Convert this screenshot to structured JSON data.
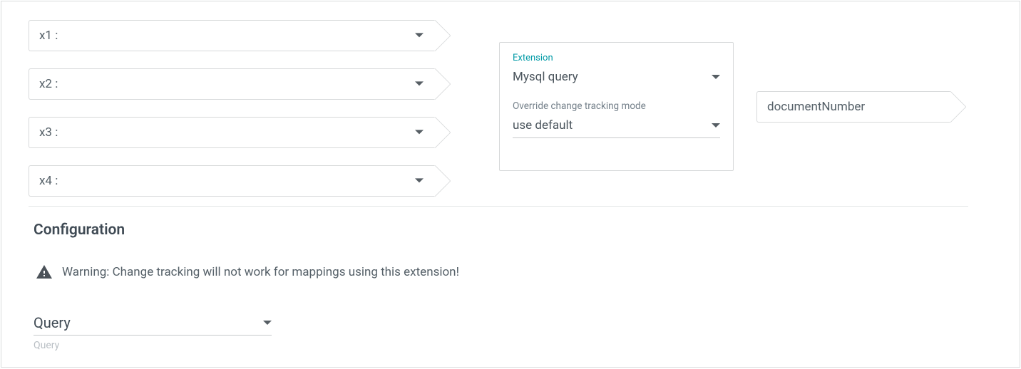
{
  "inputs": {
    "x1": "x1 :",
    "x2": "x2 :",
    "x3": "x3 :",
    "x4": "x4 :"
  },
  "centerCard": {
    "extensionLabel": "Extension",
    "extensionValue": "Mysql query",
    "overrideLabel": "Override change tracking mode",
    "overrideValue": "use default"
  },
  "output": {
    "field": "documentNumber"
  },
  "config": {
    "heading": "Configuration",
    "warning": "Warning: Change tracking will not work for mappings using this extension!",
    "queryLabel": "Query",
    "queryHint": "Query"
  }
}
